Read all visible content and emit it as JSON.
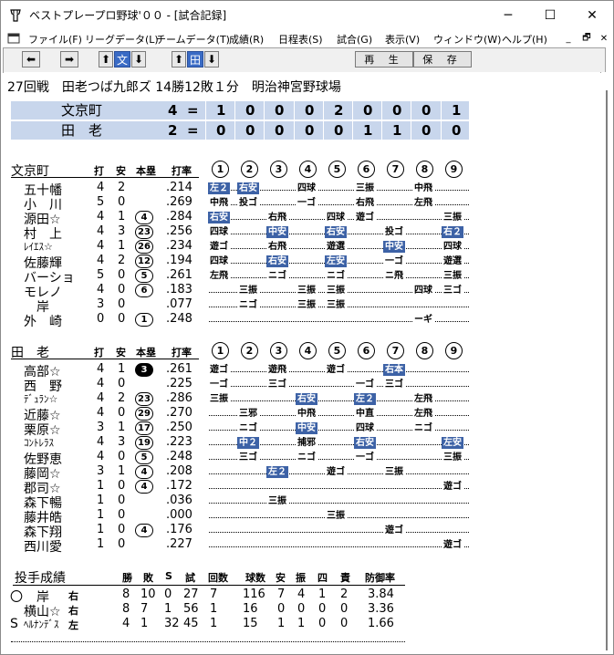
{
  "window": {
    "title": "ベストプレープロ野球'００ - [試合記録]"
  },
  "menu": [
    "ファイル(F)",
    "リーグデータ(L)",
    "チームデータ(T)",
    "成績(R)",
    "日程表(S)",
    "試合(G)",
    "表示(V)",
    "ウィンドウ(W)",
    "ヘルプ(H)"
  ],
  "toolbar": {
    "bun": "文",
    "ta": "田",
    "replay": "再 生",
    "save": "保 存"
  },
  "game": {
    "info": "27回戦　田老つば九郎ズ 14勝12敗１分　明治神宮野球場"
  },
  "scoreboard": [
    {
      "team": "文京町",
      "runs": "4",
      "eq": "=",
      "innings": [
        "1",
        "0",
        "0",
        "0",
        "2",
        "0",
        "0",
        "0",
        "1"
      ]
    },
    {
      "team": "田　老",
      "runs": "2",
      "eq": "=",
      "innings": [
        "0",
        "0",
        "0",
        "0",
        "0",
        "1",
        "1",
        "0",
        "0"
      ]
    }
  ],
  "batting_headers": {
    "da": "打",
    "an": "安",
    "hr": "本塁",
    "avg": "打率",
    "innings": [
      "1",
      "2",
      "3",
      "4",
      "5",
      "6",
      "7",
      "8",
      "9"
    ]
  },
  "team1": {
    "name": "文京町",
    "players": [
      {
        "name": "五十幡",
        "ab": "4",
        "h": "2",
        "hr": "",
        "avg": ".214",
        "res": [
          [
            "左２",
            1
          ],
          [
            "右安",
            1
          ],
          [
            "",
            0
          ],
          [
            "四球",
            0
          ],
          [
            "",
            0
          ],
          [
            "三振",
            0
          ],
          [
            "",
            0
          ],
          [
            "中飛",
            0
          ],
          [
            "",
            0
          ]
        ]
      },
      {
        "name": "小　川",
        "ab": "5",
        "h": "0",
        "hr": "",
        "avg": ".269",
        "res": [
          [
            "中飛",
            0
          ],
          [
            "投ゴ",
            0
          ],
          [
            "",
            0
          ],
          [
            "一ゴ",
            0
          ],
          [
            "",
            0
          ],
          [
            "右飛",
            0
          ],
          [
            "",
            0
          ],
          [
            "左飛",
            0
          ],
          [
            "",
            0
          ]
        ]
      },
      {
        "name": "源田☆",
        "ab": "4",
        "h": "1",
        "hr": "4",
        "avg": ".284",
        "res": [
          [
            "右安",
            1
          ],
          [
            "",
            0
          ],
          [
            "右飛",
            0
          ],
          [
            "",
            0
          ],
          [
            "四球",
            0
          ],
          [
            "遊ゴ",
            0
          ],
          [
            "",
            0
          ],
          [
            "",
            0
          ],
          [
            "三振",
            0
          ]
        ]
      },
      {
        "name": "村　上",
        "ab": "4",
        "h": "3",
        "hr": "23",
        "avg": ".256",
        "res": [
          [
            "四球",
            0
          ],
          [
            "",
            0
          ],
          [
            "中安",
            1
          ],
          [
            "",
            0
          ],
          [
            "右安",
            1
          ],
          [
            "",
            0
          ],
          [
            "投ゴ",
            0
          ],
          [
            "",
            0
          ],
          [
            "右２",
            1
          ]
        ]
      },
      {
        "name": "ﾚｲｴｽ☆",
        "ab": "4",
        "h": "1",
        "hr": "26",
        "avg": ".234",
        "res": [
          [
            "遊ゴ",
            0
          ],
          [
            "",
            0
          ],
          [
            "右飛",
            0
          ],
          [
            "",
            0
          ],
          [
            "遊選",
            0
          ],
          [
            "",
            0
          ],
          [
            "中安",
            1
          ],
          [
            "",
            0
          ],
          [
            "四球",
            0
          ]
        ]
      },
      {
        "name": "佐藤輝",
        "ab": "4",
        "h": "2",
        "hr": "12",
        "avg": ".194",
        "res": [
          [
            "四球",
            0
          ],
          [
            "",
            0
          ],
          [
            "右安",
            1
          ],
          [
            "",
            0
          ],
          [
            "左安",
            1
          ],
          [
            "",
            0
          ],
          [
            "一ゴ",
            0
          ],
          [
            "",
            0
          ],
          [
            "遊選",
            0
          ]
        ]
      },
      {
        "name": "バーショ",
        "ab": "5",
        "h": "0",
        "hr": "5",
        "avg": ".261",
        "res": [
          [
            "左飛",
            0
          ],
          [
            "",
            0
          ],
          [
            "ニゴ",
            0
          ],
          [
            "",
            0
          ],
          [
            "ニゴ",
            0
          ],
          [
            "",
            0
          ],
          [
            "ニ飛",
            0
          ],
          [
            "",
            0
          ],
          [
            "三振",
            0
          ]
        ]
      },
      {
        "name": "モレノ",
        "ab": "4",
        "h": "0",
        "hr": "6",
        "avg": ".183",
        "res": [
          [
            "",
            0
          ],
          [
            "三振",
            0
          ],
          [
            "",
            0
          ],
          [
            "三振",
            0
          ],
          [
            "三振",
            0
          ],
          [
            "",
            0
          ],
          [
            "",
            0
          ],
          [
            "四球",
            0
          ],
          [
            "三ゴ",
            0
          ]
        ]
      },
      {
        "name": "　岸",
        "ab": "3",
        "h": "0",
        "hr": "",
        "avg": ".077",
        "res": [
          [
            "",
            0
          ],
          [
            "ニゴ",
            0
          ],
          [
            "",
            0
          ],
          [
            "三振",
            0
          ],
          [
            "三振",
            0
          ],
          [
            "",
            0
          ],
          [
            "",
            0
          ],
          [
            "",
            0
          ],
          [
            "",
            0
          ]
        ]
      },
      {
        "name": "外　崎",
        "ab": "0",
        "h": "0",
        "hr": "1",
        "avg": ".248",
        "res": [
          [
            "",
            0
          ],
          [
            "",
            0
          ],
          [
            "",
            0
          ],
          [
            "",
            0
          ],
          [
            "",
            0
          ],
          [
            "",
            0
          ],
          [
            "",
            0
          ],
          [
            "ーギ",
            0
          ],
          [
            "",
            0
          ]
        ]
      }
    ]
  },
  "team2": {
    "name": "田　老",
    "players": [
      {
        "name": "高部☆",
        "ab": "4",
        "h": "1",
        "hr": "3",
        "hrb": true,
        "avg": ".261",
        "res": [
          [
            "遊ゴ",
            0
          ],
          [
            "",
            0
          ],
          [
            "遊飛",
            0
          ],
          [
            "",
            0
          ],
          [
            "遊ゴ",
            0
          ],
          [
            "",
            0
          ],
          [
            "右本",
            1
          ],
          [
            "",
            0
          ],
          [
            "",
            0
          ]
        ]
      },
      {
        "name": "西　野",
        "ab": "4",
        "h": "0",
        "hr": "",
        "avg": ".225",
        "res": [
          [
            "一ゴ",
            0
          ],
          [
            "",
            0
          ],
          [
            "三ゴ",
            0
          ],
          [
            "",
            0
          ],
          [
            "",
            0
          ],
          [
            "一ゴ",
            0
          ],
          [
            "三ゴ",
            0
          ],
          [
            "",
            0
          ],
          [
            "",
            0
          ]
        ]
      },
      {
        "name": "ﾃﾞｭﾗﾝ☆",
        "ab": "4",
        "h": "2",
        "hr": "23",
        "avg": ".286",
        "res": [
          [
            "三振",
            0
          ],
          [
            "",
            0
          ],
          [
            "",
            0
          ],
          [
            "右安",
            1
          ],
          [
            "",
            0
          ],
          [
            "左２",
            1
          ],
          [
            "",
            0
          ],
          [
            "左飛",
            0
          ],
          [
            "",
            0
          ]
        ]
      },
      {
        "name": "近藤☆",
        "ab": "4",
        "h": "0",
        "hr": "29",
        "avg": ".270",
        "res": [
          [
            "",
            0
          ],
          [
            "三邪",
            0
          ],
          [
            "",
            0
          ],
          [
            "中飛",
            0
          ],
          [
            "",
            0
          ],
          [
            "中直",
            0
          ],
          [
            "",
            0
          ],
          [
            "左飛",
            0
          ],
          [
            "",
            0
          ]
        ]
      },
      {
        "name": "栗原☆",
        "ab": "3",
        "h": "1",
        "hr": "17",
        "avg": ".250",
        "res": [
          [
            "",
            0
          ],
          [
            "ニゴ",
            0
          ],
          [
            "",
            0
          ],
          [
            "中安",
            1
          ],
          [
            "",
            0
          ],
          [
            "四球",
            0
          ],
          [
            "",
            0
          ],
          [
            "ニゴ",
            0
          ],
          [
            "",
            0
          ]
        ]
      },
      {
        "name": "ｺﾝﾄﾚﾗｽ",
        "ab": "4",
        "h": "3",
        "hr": "19",
        "avg": ".223",
        "res": [
          [
            "",
            0
          ],
          [
            "中２",
            1
          ],
          [
            "",
            0
          ],
          [
            "捕邪",
            0
          ],
          [
            "",
            0
          ],
          [
            "右安",
            1
          ],
          [
            "",
            0
          ],
          [
            "",
            0
          ],
          [
            "左安",
            1
          ]
        ]
      },
      {
        "name": "佐野恵",
        "ab": "4",
        "h": "0",
        "hr": "5",
        "avg": ".248",
        "res": [
          [
            "",
            0
          ],
          [
            "三ゴ",
            0
          ],
          [
            "",
            0
          ],
          [
            "ニゴ",
            0
          ],
          [
            "",
            0
          ],
          [
            "一ゴ",
            0
          ],
          [
            "",
            0
          ],
          [
            "",
            0
          ],
          [
            "三振",
            0
          ]
        ]
      },
      {
        "name": "藤岡☆",
        "ab": "3",
        "h": "1",
        "hr": "4",
        "avg": ".208",
        "res": [
          [
            "",
            0
          ],
          [
            "",
            0
          ],
          [
            "左２",
            1
          ],
          [
            "",
            0
          ],
          [
            "遊ゴ",
            0
          ],
          [
            "",
            0
          ],
          [
            "三振",
            0
          ],
          [
            "",
            0
          ],
          [
            "",
            0
          ]
        ]
      },
      {
        "name": "郡司☆",
        "ab": "1",
        "h": "0",
        "hr": "4",
        "avg": ".172",
        "res": [
          [
            "",
            0
          ],
          [
            "",
            0
          ],
          [
            "",
            0
          ],
          [
            "",
            0
          ],
          [
            "",
            0
          ],
          [
            "",
            0
          ],
          [
            "",
            0
          ],
          [
            "",
            0
          ],
          [
            "遊ゴ",
            0
          ]
        ]
      },
      {
        "name": "森下暢",
        "ab": "1",
        "h": "0",
        "hr": "",
        "avg": ".036",
        "res": [
          [
            "",
            0
          ],
          [
            "",
            0
          ],
          [
            "三振",
            0
          ],
          [
            "",
            0
          ],
          [
            "",
            0
          ],
          [
            "",
            0
          ],
          [
            "",
            0
          ],
          [
            "",
            0
          ],
          [
            "",
            0
          ]
        ]
      },
      {
        "name": "藤井皓",
        "ab": "1",
        "h": "0",
        "hr": "",
        "avg": ".000",
        "res": [
          [
            "",
            0
          ],
          [
            "",
            0
          ],
          [
            "",
            0
          ],
          [
            "",
            0
          ],
          [
            "三振",
            0
          ],
          [
            "",
            0
          ],
          [
            "",
            0
          ],
          [
            "",
            0
          ],
          [
            "",
            0
          ]
        ]
      },
      {
        "name": "森下翔",
        "ab": "1",
        "h": "0",
        "hr": "4",
        "avg": ".176",
        "res": [
          [
            "",
            0
          ],
          [
            "",
            0
          ],
          [
            "",
            0
          ],
          [
            "",
            0
          ],
          [
            "",
            0
          ],
          [
            "",
            0
          ],
          [
            "遊ゴ",
            0
          ],
          [
            "",
            0
          ],
          [
            "",
            0
          ]
        ]
      },
      {
        "name": "西川愛",
        "ab": "1",
        "h": "0",
        "hr": "",
        "avg": ".227",
        "res": [
          [
            "",
            0
          ],
          [
            "",
            0
          ],
          [
            "",
            0
          ],
          [
            "",
            0
          ],
          [
            "",
            0
          ],
          [
            "",
            0
          ],
          [
            "",
            0
          ],
          [
            "",
            0
          ],
          [
            "遊ゴ",
            0
          ]
        ]
      }
    ]
  },
  "pitching": {
    "title": "投手成績",
    "headers": [
      "勝",
      "敗",
      "S",
      "試",
      "回数",
      "球数",
      "安",
      "振",
      "四",
      "責",
      "防御率"
    ],
    "rows": [
      {
        "mark": "〇",
        "name": "　岸",
        "hand": "右",
        "w": "8",
        "l": "10",
        "s": "0",
        "g": "27",
        "ip": "7",
        "np": "116",
        "h": "7",
        "k": "4",
        "bb": "1",
        "er": "2",
        "era": "3.84"
      },
      {
        "mark": "",
        "name": "横山☆",
        "hand": "右",
        "w": "8",
        "l": "7",
        "s": "1",
        "g": "56",
        "ip": "1",
        "np": "16",
        "h": "0",
        "k": "0",
        "bb": "0",
        "er": "0",
        "era": "3.36"
      },
      {
        "mark": "S",
        "name": "ﾍﾙﾅﾝﾃﾞｽ",
        "hand": "左",
        "w": "4",
        "l": "1",
        "s": "32",
        "g": "45",
        "ip": "1",
        "np": "15",
        "h": "1",
        "k": "1",
        "bb": "0",
        "er": "0",
        "era": "1.66"
      }
    ]
  }
}
